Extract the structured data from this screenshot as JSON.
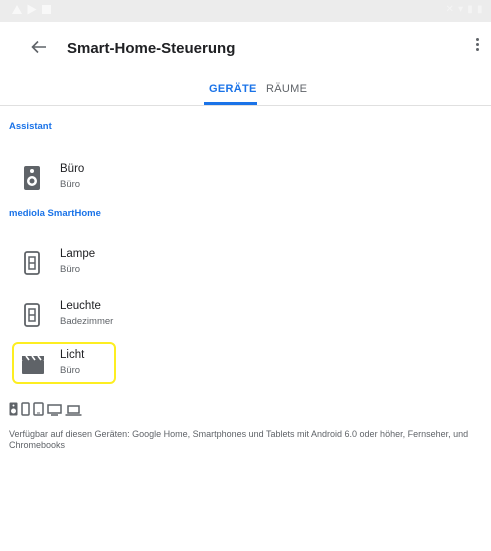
{
  "app": {
    "title": "Smart-Home-Steuerung"
  },
  "tabs": {
    "devices": "GERÄTE",
    "rooms": "RÄUME"
  },
  "sections": {
    "assistant": {
      "label": "Assistant",
      "devices": [
        {
          "name": "Büro",
          "room": "Büro",
          "icon": "speaker-icon"
        }
      ]
    },
    "mediola": {
      "label": "mediola SmartHome",
      "devices": [
        {
          "name": "Lampe",
          "room": "Büro",
          "icon": "light-switch-icon"
        },
        {
          "name": "Leuchte",
          "room": "Badezimmer",
          "icon": "light-switch-icon"
        },
        {
          "name": "Licht",
          "room": "Büro",
          "icon": "scene-clapperboard-icon"
        }
      ]
    }
  },
  "availability": {
    "icons": [
      "speaker-icon",
      "phone-icon",
      "tablet-icon",
      "tv-icon",
      "laptop-icon"
    ],
    "text": "Verfügbar auf diesen Geräten: Google Home, Smartphones und Tablets mit Android 6.0 oder höher, Fernseher, und Chromebooks"
  },
  "colors": {
    "accent": "#1a73e8",
    "highlight": "#fdee21",
    "icon": "#5f6368"
  }
}
